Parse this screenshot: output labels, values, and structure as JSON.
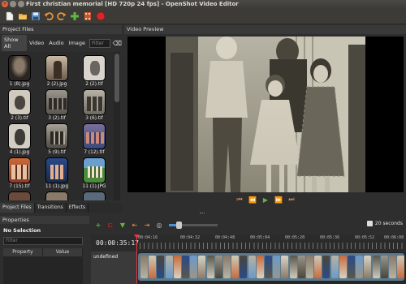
{
  "window": {
    "title": "First christian memorial [HD 720p 24 fps] - OpenShot Video Editor"
  },
  "toolbar": {
    "icons": [
      "new-project-icon",
      "open-project-icon",
      "save-project-icon",
      "undo-icon",
      "redo-icon",
      "add-file-icon",
      "export-icon",
      "record-icon"
    ]
  },
  "project_files": {
    "header": "Project Files",
    "filters": [
      "Show All",
      "Video",
      "Audio",
      "Image"
    ],
    "filter_placeholder": "Filter",
    "items": [
      {
        "label": "1 (8).jpg"
      },
      {
        "label": "2 (2).jpg"
      },
      {
        "label": "2 (2).tif"
      },
      {
        "label": "2 (3).tif"
      },
      {
        "label": "3 (2).tif"
      },
      {
        "label": "3 (6).tif"
      },
      {
        "label": "4 (1).jpg"
      },
      {
        "label": "5 (9).tif"
      },
      {
        "label": "7 (12).tif"
      },
      {
        "label": "7 (15).tif"
      },
      {
        "label": "11 (1).jpg"
      },
      {
        "label": "11 (1).JPG"
      }
    ]
  },
  "left_tabs": [
    "Project Files",
    "Transitions",
    "Effects"
  ],
  "properties": {
    "header": "Properties",
    "selection": "No Selection",
    "filter_placeholder": "Filter",
    "columns": [
      "Property",
      "Value"
    ]
  },
  "video_preview": {
    "header": "Video Preview"
  },
  "timeline": {
    "current_time": "00:00:35:17",
    "zoom_label": "20 seconds",
    "zoom_fraction": 0.2,
    "ruler_marks": [
      "00:04:16",
      "00:04:32",
      "00:04:48",
      "00:05:04",
      "00:05:20",
      "00:05:36",
      "00:05:52",
      "00:06:08"
    ],
    "track_label": "undefined"
  }
}
